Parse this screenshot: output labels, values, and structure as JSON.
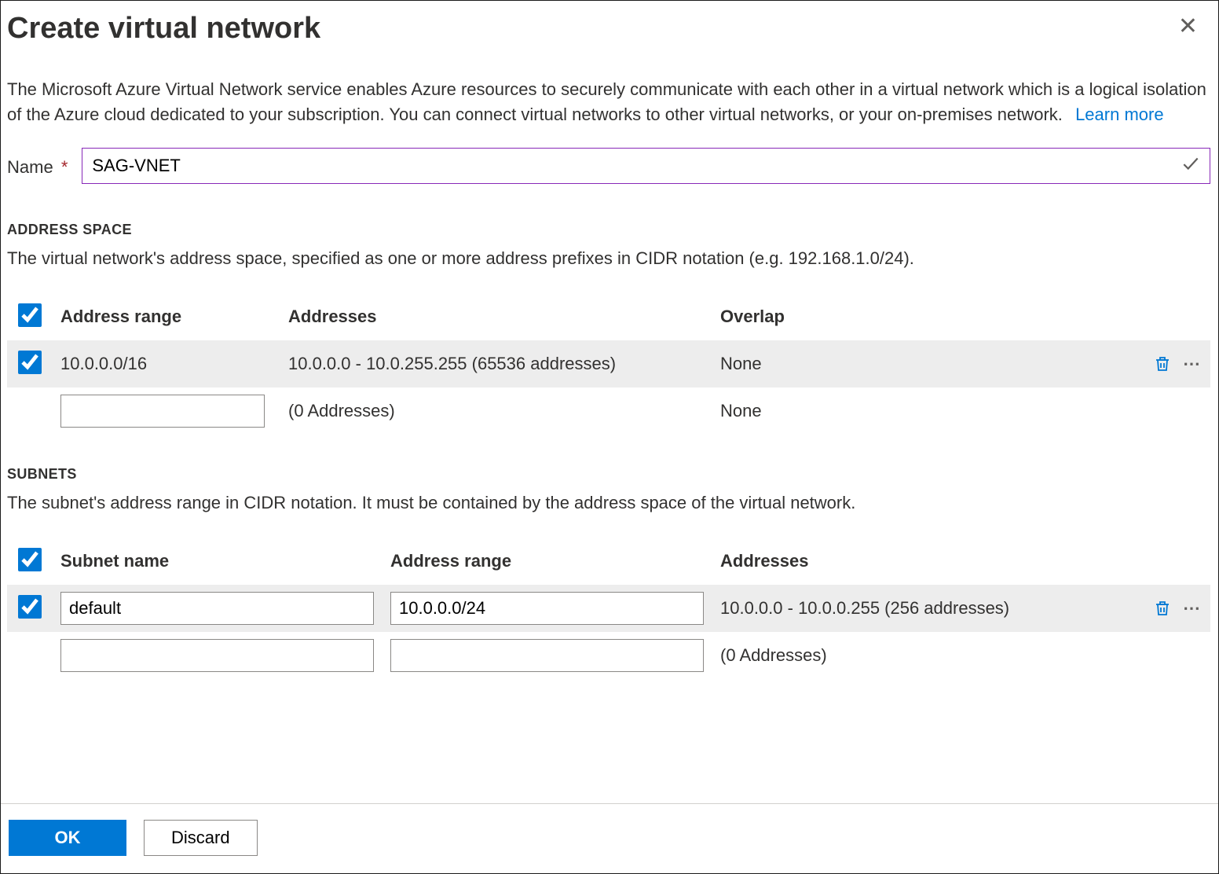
{
  "title": "Create virtual network",
  "description": "The Microsoft Azure Virtual Network service enables Azure resources to securely communicate with each other in a virtual network which is a logical isolation of the Azure cloud dedicated to your subscription. You can connect virtual networks to other virtual networks, or your on-premises network.",
  "learn_more": "Learn more",
  "name_label": "Name",
  "name_value": "SAG-VNET",
  "address_space": {
    "heading": "ADDRESS SPACE",
    "description": "The virtual network's address space, specified as one or more address prefixes in CIDR notation (e.g. 192.168.1.0/24).",
    "headers": {
      "range": "Address range",
      "addresses": "Addresses",
      "overlap": "Overlap"
    },
    "rows": [
      {
        "range": "10.0.0.0/16",
        "addresses": "10.0.0.0 - 10.0.255.255 (65536 addresses)",
        "overlap": "None"
      }
    ],
    "new_row": {
      "range": "",
      "addresses": "(0 Addresses)",
      "overlap": "None"
    }
  },
  "subnets": {
    "heading": "SUBNETS",
    "description": "The subnet's address range in CIDR notation. It must be contained by the address space of the virtual network.",
    "headers": {
      "name": "Subnet name",
      "range": "Address range",
      "addresses": "Addresses"
    },
    "rows": [
      {
        "name": "default",
        "range": "10.0.0.0/24",
        "addresses": "10.0.0.0 - 10.0.0.255 (256 addresses)"
      }
    ],
    "new_row": {
      "name": "",
      "range": "",
      "addresses": "(0 Addresses)"
    }
  },
  "footer": {
    "ok": "OK",
    "discard": "Discard"
  }
}
